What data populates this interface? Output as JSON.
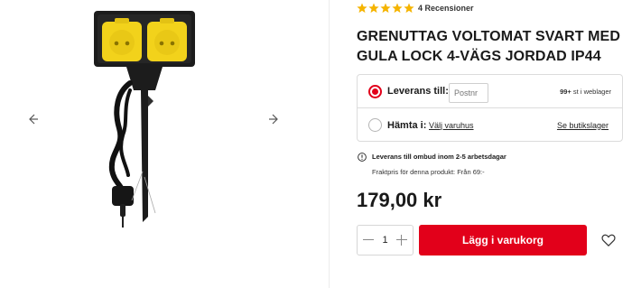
{
  "rating": {
    "stars": 5,
    "reviews_label": "4 Recensioner",
    "star_color": "#f5b400"
  },
  "product": {
    "title": "GRENUTTAG VOLTOMAT SVART MED GULA LOCK 4-VÄGS JORDAD IP44",
    "price": "179,00 kr"
  },
  "delivery": {
    "ship_label": "Leverans till:",
    "postnr_placeholder": "Postnr",
    "stock_count": "99+",
    "stock_text": " st i weblager",
    "pickup_label": "Hämta i:",
    "pickup_link": "Välj varuhus",
    "store_stock_link": "Se butikslager"
  },
  "shipping": {
    "ombud_text": "Leverans till ombud inom 2-5 arbetsdagar",
    "freight_text": "Fraktpris för denna produkt: Från 69:-"
  },
  "cart": {
    "quantity": "1",
    "add_label": "Lägg i varukorg"
  },
  "icons": {
    "prev": "chevron-left-icon",
    "next": "chevron-right-icon",
    "info": "info-icon",
    "wishlist": "heart-icon"
  },
  "colors": {
    "accent": "#e2001a",
    "product_body": "#1c1c1c",
    "product_lids": "#f2d21b"
  }
}
